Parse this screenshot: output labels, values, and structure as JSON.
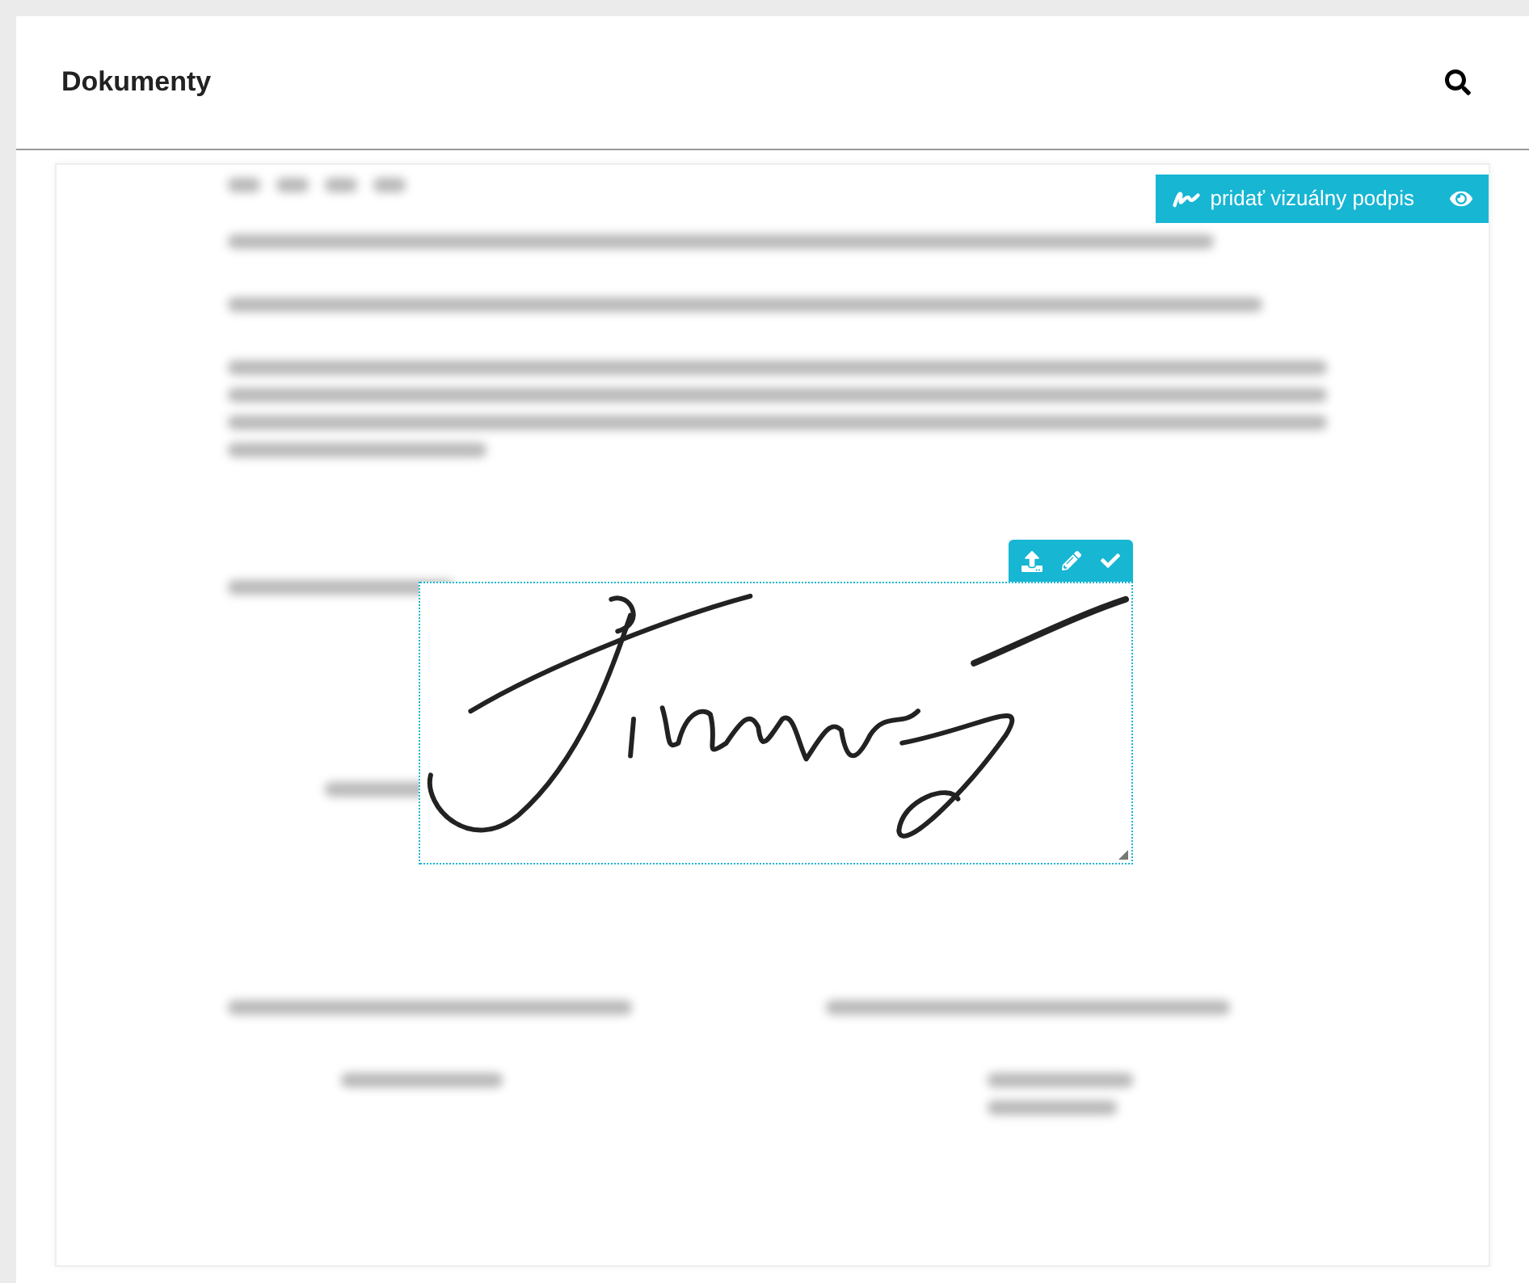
{
  "header": {
    "title": "Dokumenty"
  },
  "document": {
    "add_signature_button": {
      "label": "pridať vizuálny podpis"
    }
  }
}
